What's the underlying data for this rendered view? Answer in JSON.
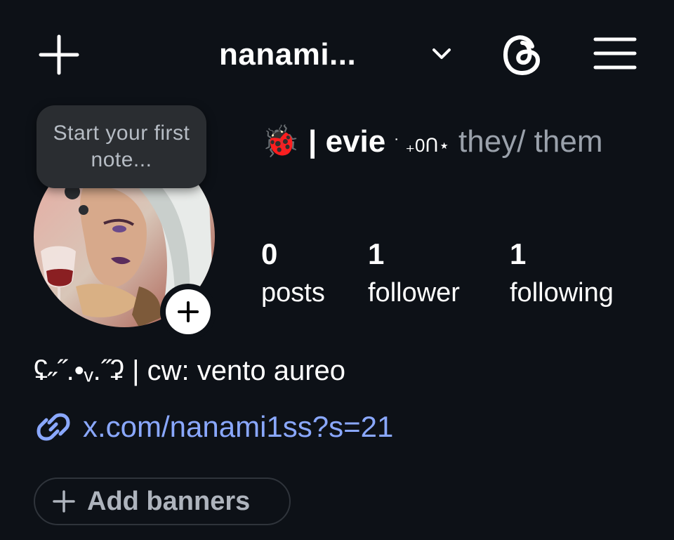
{
  "header": {
    "username": "nanami...",
    "icons": [
      "plus-icon",
      "chevron-down-icon",
      "threads-icon",
      "menu-icon"
    ]
  },
  "note": {
    "placeholder": "Start your first note..."
  },
  "profile": {
    "name_emoji": "🐞",
    "name_bold": "| evie",
    "name_decor": "˙ ₊0ᑎ⋆",
    "pronouns": " they/ them",
    "stats": [
      {
        "value": "0",
        "label": "posts"
      },
      {
        "value": "1",
        "label": "follower"
      },
      {
        "value": "1",
        "label": "following"
      }
    ],
    "bio": "ʢ˶˝.•ᵥ.˝ʡ | cw: vento aureo",
    "link": "x.com/nanami1ss?s=21",
    "add_banners": "Add banners"
  },
  "colors": {
    "background": "#0d1117",
    "link": "#8aa8ff",
    "muted": "#9aa1ab",
    "note_bubble": "#2a2d31"
  }
}
